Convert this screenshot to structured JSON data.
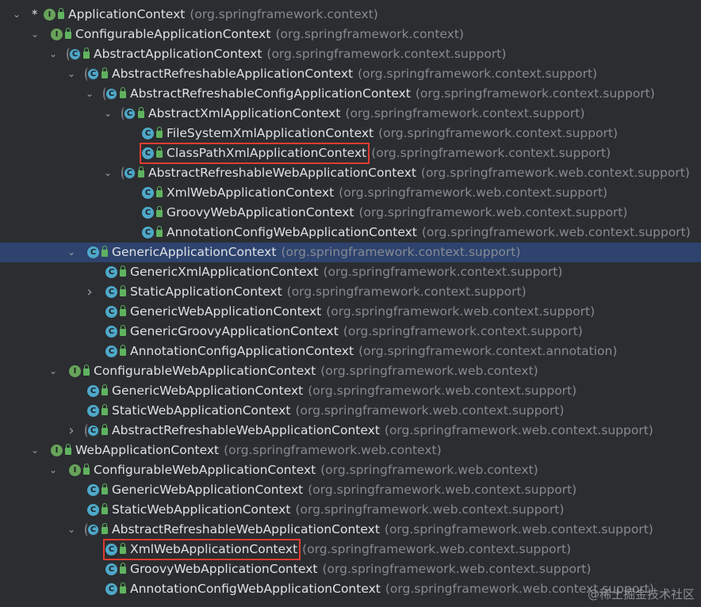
{
  "rows": [
    {
      "name": "ApplicationContext",
      "pkg": "(org.springframework.context)",
      "icon": "interface",
      "arrow": "down",
      "star": true
    },
    {
      "name": "ConfigurableApplicationContext",
      "pkg": "(org.springframework.context)",
      "icon": "interface",
      "arrow": "down"
    },
    {
      "name": "AbstractApplicationContext",
      "pkg": "(org.springframework.context.support)",
      "icon": "abstract-class",
      "arrow": "down"
    },
    {
      "name": "AbstractRefreshableApplicationContext",
      "pkg": "(org.springframework.context.support)",
      "icon": "abstract-class",
      "arrow": "down"
    },
    {
      "name": "AbstractRefreshableConfigApplicationContext",
      "pkg": "(org.springframework.context.support)",
      "icon": "abstract-class",
      "arrow": "down"
    },
    {
      "name": "AbstractXmlApplicationContext",
      "pkg": "(org.springframework.context.support)",
      "icon": "abstract-class",
      "arrow": "down"
    },
    {
      "name": "FileSystemXmlApplicationContext",
      "pkg": "(org.springframework.context.support)",
      "icon": "class",
      "arrow": ""
    },
    {
      "name": "ClassPathXmlApplicationContext",
      "pkg": "(org.springframework.context.support)",
      "icon": "class",
      "arrow": "",
      "boxed": true
    },
    {
      "name": "AbstractRefreshableWebApplicationContext",
      "pkg": "(org.springframework.web.context.support)",
      "icon": "abstract-class",
      "arrow": "down"
    },
    {
      "name": "XmlWebApplicationContext",
      "pkg": "(org.springframework.web.context.support)",
      "icon": "class",
      "arrow": ""
    },
    {
      "name": "GroovyWebApplicationContext",
      "pkg": "(org.springframework.web.context.support)",
      "icon": "class",
      "arrow": ""
    },
    {
      "name": "AnnotationConfigWebApplicationContext",
      "pkg": "(org.springframework.web.context.support)",
      "icon": "class",
      "arrow": ""
    },
    {
      "name": "GenericApplicationContext",
      "pkg": "(org.springframework.context.support)",
      "icon": "class",
      "arrow": "down",
      "selected": true
    },
    {
      "name": "GenericXmlApplicationContext",
      "pkg": "(org.springframework.context.support)",
      "icon": "class",
      "arrow": ""
    },
    {
      "name": "StaticApplicationContext",
      "pkg": "(org.springframework.context.support)",
      "icon": "class",
      "arrow": "right"
    },
    {
      "name": "GenericWebApplicationContext",
      "pkg": "(org.springframework.web.context.support)",
      "icon": "class",
      "arrow": ""
    },
    {
      "name": "GenericGroovyApplicationContext",
      "pkg": "(org.springframework.context.support)",
      "icon": "class",
      "arrow": ""
    },
    {
      "name": "AnnotationConfigApplicationContext",
      "pkg": "(org.springframework.context.annotation)",
      "icon": "class",
      "arrow": ""
    },
    {
      "name": "ConfigurableWebApplicationContext",
      "pkg": "(org.springframework.web.context)",
      "icon": "interface",
      "arrow": "down"
    },
    {
      "name": "GenericWebApplicationContext",
      "pkg": "(org.springframework.web.context.support)",
      "icon": "class",
      "arrow": ""
    },
    {
      "name": "StaticWebApplicationContext",
      "pkg": "(org.springframework.web.context.support)",
      "icon": "class",
      "arrow": ""
    },
    {
      "name": "AbstractRefreshableWebApplicationContext",
      "pkg": "(org.springframework.web.context.support)",
      "icon": "abstract-class",
      "arrow": "right"
    },
    {
      "name": "WebApplicationContext",
      "pkg": "(org.springframework.web.context)",
      "icon": "interface",
      "arrow": "down"
    },
    {
      "name": "ConfigurableWebApplicationContext",
      "pkg": "(org.springframework.web.context)",
      "icon": "interface",
      "arrow": "down"
    },
    {
      "name": "GenericWebApplicationContext",
      "pkg": "(org.springframework.web.context.support)",
      "icon": "class",
      "arrow": ""
    },
    {
      "name": "StaticWebApplicationContext",
      "pkg": "(org.springframework.web.context.support)",
      "icon": "class",
      "arrow": ""
    },
    {
      "name": "AbstractRefreshableWebApplicationContext",
      "pkg": "(org.springframework.web.context.support)",
      "icon": "abstract-class",
      "arrow": "down"
    },
    {
      "name": "XmlWebApplicationContext",
      "pkg": "(org.springframework.web.context.support)",
      "icon": "class",
      "arrow": "",
      "boxed": true
    },
    {
      "name": "GroovyWebApplicationContext",
      "pkg": "(org.springframework.web.context.support)",
      "icon": "class",
      "arrow": ""
    },
    {
      "name": "AnnotationConfigWebApplicationContext",
      "pkg": "(org.springframework.web.context.support)",
      "icon": "class",
      "arrow": ""
    }
  ],
  "watermark": "@稀土掘金技术社区",
  "colors": {
    "class_icon": "#4ea8c9",
    "interface_icon": "#67a35a",
    "highlight_box": "#e03c31"
  }
}
